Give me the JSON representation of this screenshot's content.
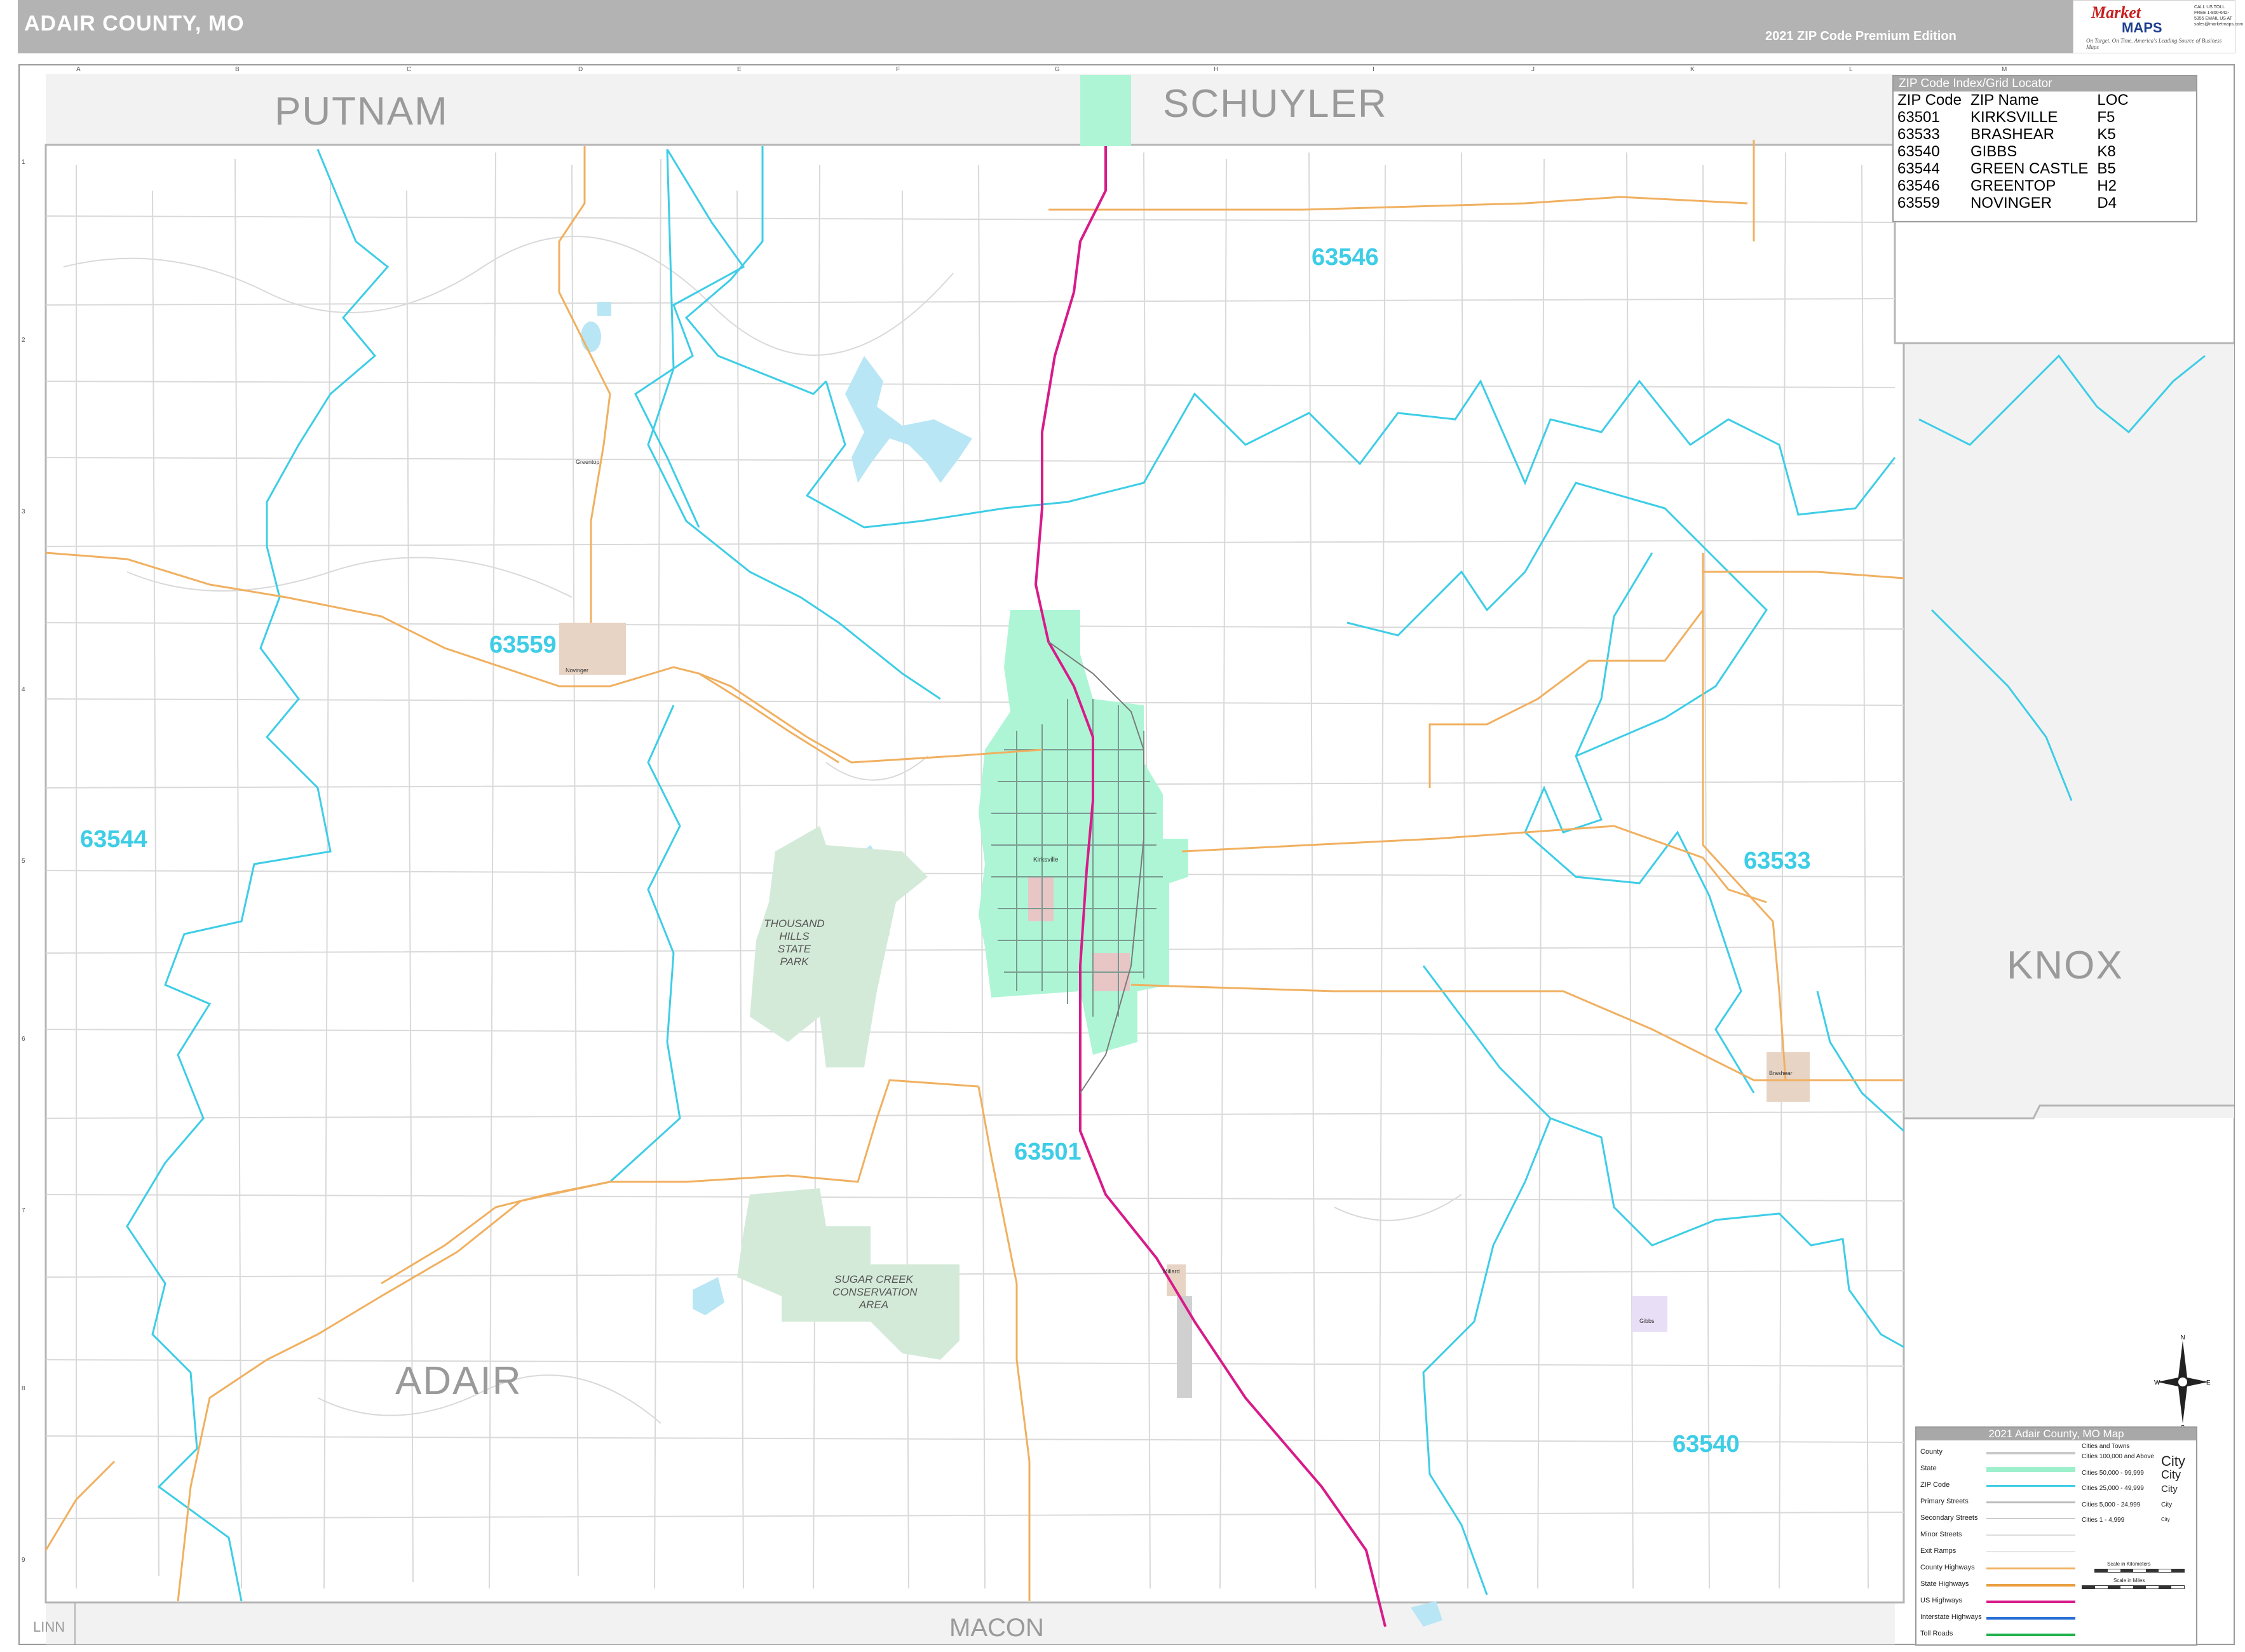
{
  "header": {
    "title": "ADAIR COUNTY, MO",
    "edition": "2021 ZIP Code Premium Edition"
  },
  "logo": {
    "brand_top": "Market",
    "brand_bottom": "MAPS",
    "tagline": "On Target. On Time. America's Leading Source of Business Maps",
    "contact": "CALL US TOLL FREE 1-800-642-5355 EMAIL US AT sales@marketmaps.com"
  },
  "grid": {
    "columns": [
      "A",
      "B",
      "C",
      "D",
      "E",
      "F",
      "G",
      "H",
      "I",
      "J",
      "K",
      "L",
      "M"
    ],
    "rows": [
      "1",
      "2",
      "3",
      "4",
      "5",
      "6",
      "7",
      "8",
      "9"
    ]
  },
  "counties": {
    "putnam": "PUTNAM",
    "schuyler": "SCHUYLER",
    "knox": "KNOX",
    "adair": "ADAIR",
    "macon": "MACON",
    "linn": "LINN"
  },
  "zip_labels": {
    "z63546": "63546",
    "z63559": "63559",
    "z63544": "63544",
    "z63533": "63533",
    "z63501": "63501",
    "z63540": "63540"
  },
  "parks": {
    "thousand_hills": "THOUSAND HILLS STATE PARK",
    "sugar_creek": "SUGAR CREEK CONSERVATION AREA"
  },
  "zip_index": {
    "title": "ZIP Code Index/Grid Locator",
    "columns": [
      "ZIP Code",
      "ZIP Name",
      "LOC"
    ],
    "rows": [
      [
        "63501",
        "KIRKSVILLE",
        "F5"
      ],
      [
        "63533",
        "BRASHEAR",
        "K5"
      ],
      [
        "63540",
        "GIBBS",
        "K8"
      ],
      [
        "63544",
        "GREEN CASTLE",
        "B5"
      ],
      [
        "63546",
        "GREENTOP",
        "H2"
      ],
      [
        "63559",
        "NOVINGER",
        "D4"
      ]
    ]
  },
  "legend": {
    "title": "2021 Adair County, MO Map",
    "items": [
      "County",
      "State",
      "ZIP Code",
      "Primary Streets",
      "Secondary Streets",
      "Minor Streets",
      "Exit Ramps",
      "County Highways",
      "State Highways",
      "US Highways",
      "Interstate Highways",
      "Toll Roads"
    ],
    "city_header": "Cities and Towns",
    "city_rows": [
      {
        "label": "Cities 100,000 and Above",
        "sample": "City"
      },
      {
        "label": "Cities 50,000 - 99,999",
        "sample": "City"
      },
      {
        "label": "Cities 25,000 - 49,999",
        "sample": "City"
      },
      {
        "label": "Cities 5,000 - 24,999",
        "sample": "City"
      },
      {
        "label": "Cities 1 - 4,999",
        "sample": "City"
      }
    ],
    "scale_km": "Scale in Kilometers",
    "scale_mi": "Scale in Miles",
    "colors": {
      "county": "#c8c8c8",
      "state": "#9ef0cc",
      "zip": "#3ecde6",
      "county_hwy": "#f0b060",
      "state_hwy": "#e8a040",
      "us_hwy": "#d81b8a",
      "interstate": "#2a6fd6",
      "toll": "#22b14c"
    }
  },
  "compass": {
    "n": "N",
    "s": "S",
    "e": "E",
    "w": "W"
  },
  "towns": {
    "novinger": "Novinger",
    "brashear": "Brashear",
    "gibbs": "Gibbs",
    "kirksville": "Kirksville",
    "millard": "Millard",
    "greentop": "Greentop"
  }
}
